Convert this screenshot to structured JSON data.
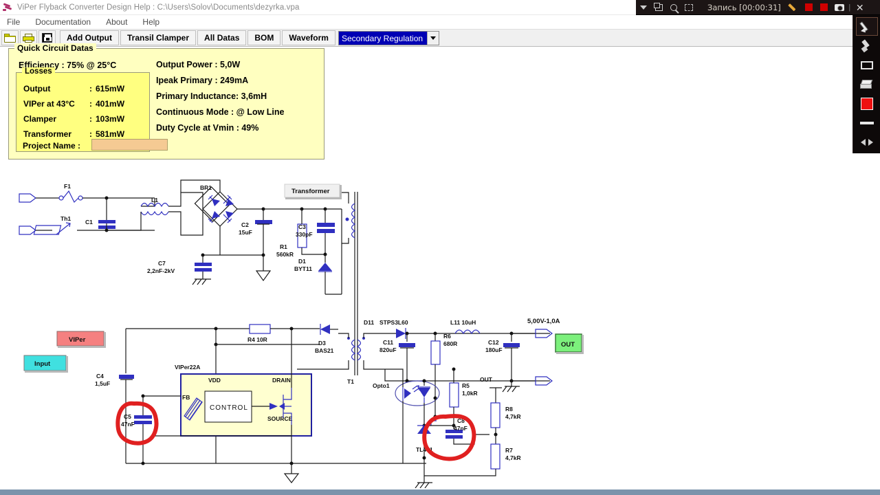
{
  "window": {
    "icon": "app-icon",
    "title": "ViPer Flyback Converter Design Help :  C:\\Users\\Solov\\Documents\\dezyrka.vpa"
  },
  "menubar": {
    "items": [
      {
        "label": "File"
      },
      {
        "label": "Documentation"
      },
      {
        "label": "About"
      },
      {
        "label": "Help"
      }
    ]
  },
  "toolbar": {
    "icon_buttons": [
      {
        "name": "open-icon",
        "label": "Open"
      },
      {
        "name": "print-icon",
        "label": "Print"
      },
      {
        "name": "save-icon",
        "label": "Save"
      }
    ],
    "buttons": [
      {
        "label": "Add Output"
      },
      {
        "label": "Transil Clamper"
      },
      {
        "label": "All Datas"
      },
      {
        "label": "BOM"
      },
      {
        "label": "Waveform"
      }
    ],
    "dropdown": {
      "value": "Secondary Regulation",
      "arrow": "chevron-down-icon"
    }
  },
  "quick_circuit_datas": {
    "legend": "Quick Circuit Datas",
    "efficiency": "Efficiency : 75% @ 25°C",
    "losses": {
      "legend": "Losses",
      "rows": [
        {
          "key": "Output",
          "sep": ":",
          "value": "615mW"
        },
        {
          "key": "VIPer at 43°C",
          "sep": ":",
          "value": "401mW"
        },
        {
          "key": "Clamper",
          "sep": ":",
          "value": "103mW"
        },
        {
          "key": "Transformer",
          "sep": ":",
          "value": "581mW"
        }
      ]
    },
    "right_column": [
      "Output Power : 5,0W",
      "Ipeak Primary : 249mA",
      "Primary Inductance: 3,6mH",
      "Continuous Mode : @ Low Line",
      "Duty Cycle at Vmin : 49%"
    ],
    "project_name_label": "Project Name :",
    "project_name_value": ""
  },
  "schematic": {
    "blocks": [
      {
        "name": "input-block",
        "label": "Input",
        "color": "#40e0e0"
      },
      {
        "name": "viper-block",
        "label": "VIPer",
        "color": "#f58080"
      },
      {
        "name": "out-block",
        "label": "OUT",
        "color": "#7cf07c"
      },
      {
        "name": "transformer-block",
        "label": "Transformer",
        "color": "#f0f0f0"
      }
    ],
    "ic": {
      "name": "VIPer22A",
      "inner_label": "CONTROL",
      "pins": [
        "VDD",
        "DRAIN",
        "FB",
        "SOURCE"
      ]
    },
    "components": [
      {
        "ref": "F1",
        "value": ""
      },
      {
        "ref": "Th1",
        "value": ""
      },
      {
        "ref": "C1",
        "value": ""
      },
      {
        "ref": "L1",
        "value": ""
      },
      {
        "ref": "BR1",
        "value": ""
      },
      {
        "ref": "C2",
        "value": "15uF"
      },
      {
        "ref": "C7",
        "value": "2,2nF-2kV"
      },
      {
        "ref": "R1",
        "value": "560kR"
      },
      {
        "ref": "C3",
        "value": "330pF"
      },
      {
        "ref": "D1",
        "value": "BYT11"
      },
      {
        "ref": "C4",
        "value": "1,5uF"
      },
      {
        "ref": "C5",
        "value": "47nF"
      },
      {
        "ref": "R4",
        "value": "10R"
      },
      {
        "ref": "D3",
        "value": "BAS21"
      },
      {
        "ref": "T1",
        "value": ""
      },
      {
        "ref": "D11",
        "value": "STPS3L60"
      },
      {
        "ref": "C11",
        "value": "820uF"
      },
      {
        "ref": "R6",
        "value": "680R"
      },
      {
        "ref": "L11",
        "value": "10uH"
      },
      {
        "ref": "C12",
        "value": "180uF"
      },
      {
        "ref": "Opto1",
        "value": ""
      },
      {
        "ref": "R5",
        "value": "1,0kR"
      },
      {
        "ref": "C8",
        "value": "47nF"
      },
      {
        "ref": "TL431",
        "value": ""
      },
      {
        "ref": "R8",
        "value": "4,7kR"
      },
      {
        "ref": "R7",
        "value": "4,7kR"
      }
    ],
    "labels": {
      "output_rating": "5,00V-1,0A",
      "out_node": "OUT"
    },
    "annotations": [
      {
        "name": "red-circle-c5",
        "color": "#e02020"
      },
      {
        "name": "red-circle-c8",
        "color": "#e02020"
      }
    ]
  },
  "recorder": {
    "status_text": "Запись [00:00:31]",
    "left_icons": [
      "chevron-down-icon",
      "windows-icon",
      "search-icon",
      "crop-icon"
    ],
    "right_icons": [
      "pencil-icon",
      "stop-icon",
      "record-icon",
      "camera-icon",
      "close-icon"
    ]
  },
  "annotation_tools": [
    {
      "name": "pencil-tool",
      "label": "Pencil",
      "selected": true
    },
    {
      "name": "marker-tool",
      "label": "Marker",
      "selected": false
    },
    {
      "name": "rectangle-tool",
      "label": "Rectangle",
      "selected": false
    },
    {
      "name": "eraser-tool",
      "label": "Eraser",
      "selected": false
    },
    {
      "name": "color-swatch",
      "label": "Color",
      "selected": false,
      "color": "#ee1111"
    },
    {
      "name": "thickness-tool",
      "label": "Line thickness",
      "selected": false
    },
    {
      "name": "arrows-tool",
      "label": "Arrows",
      "selected": false
    }
  ]
}
